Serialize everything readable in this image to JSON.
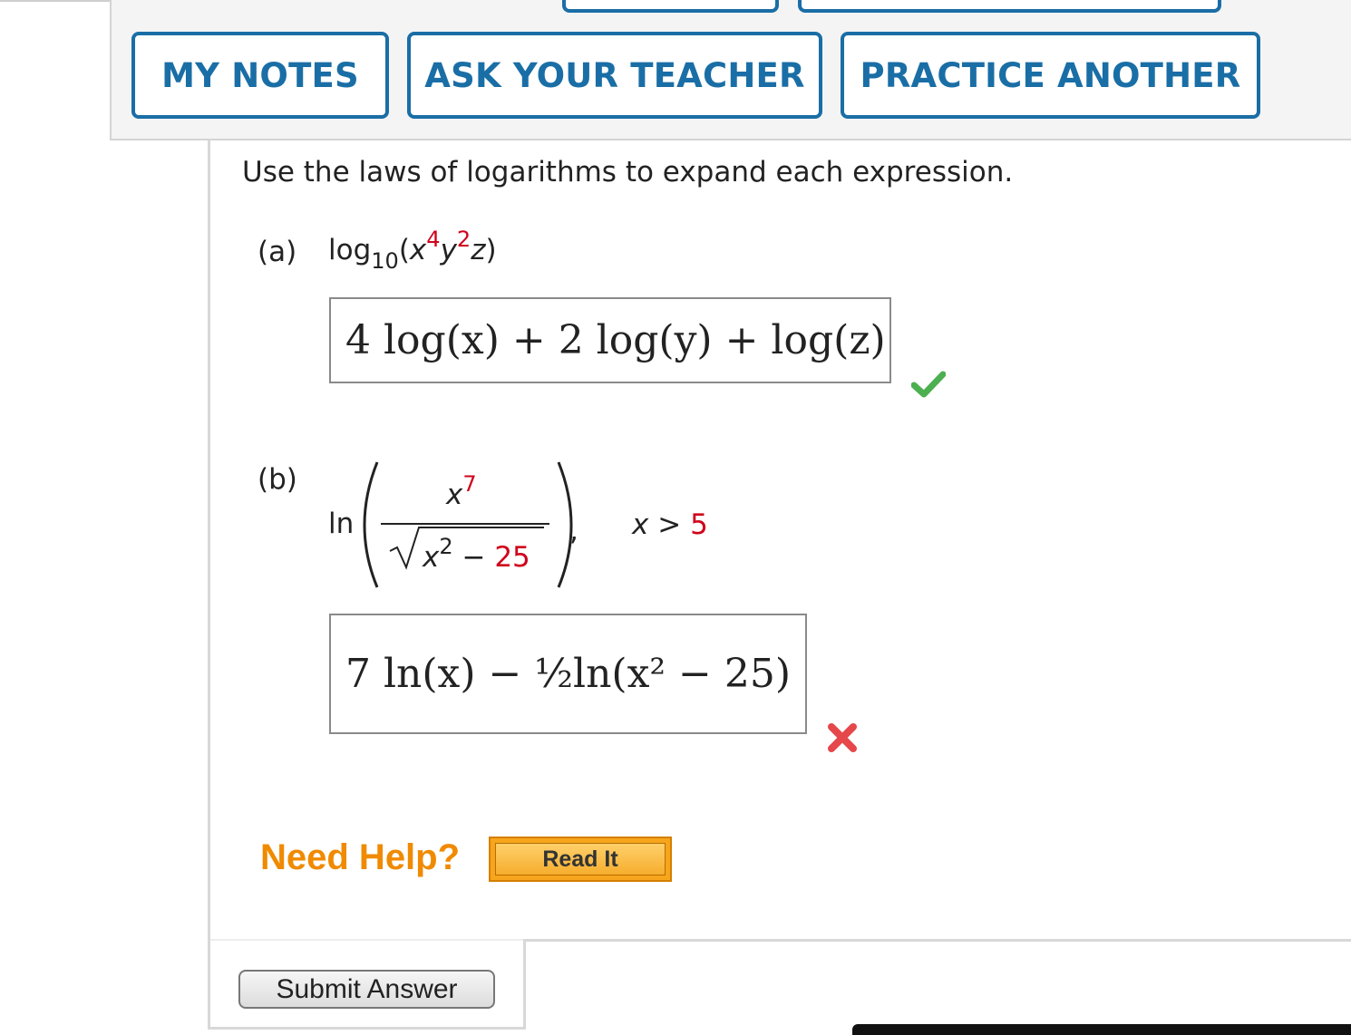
{
  "toolbar": {
    "my_notes": "MY NOTES",
    "ask_teacher": "ASK YOUR TEACHER",
    "practice_another": "PRACTICE ANOTHER"
  },
  "question": {
    "instructions": "Use the laws of logarithms to expand each expression.",
    "part_a": {
      "label": "(a)",
      "func": "log",
      "base": "10",
      "x_power": "4",
      "y_power": "2",
      "answer": "4 log(x) + 2 log(y) + log(z)",
      "status": "correct"
    },
    "part_b": {
      "label": "(b)",
      "func": "ln",
      "num_power": "7",
      "den_power": "2",
      "den_const": "25",
      "condition_var": "x",
      "condition_op": ">",
      "condition_value": "5",
      "answer": "7 ln(x) − ½ln(x² − 25)",
      "status": "incorrect"
    }
  },
  "help": {
    "need_help": "Need Help?",
    "read_it": "Read It"
  },
  "actions": {
    "submit": "Submit Answer"
  },
  "colors": {
    "brand_blue": "#1a6ea6",
    "highlight_red": "#d0021b",
    "help_orange": "#f08a00",
    "correct_green": "#4caf50",
    "incorrect_red": "#e5474b"
  }
}
